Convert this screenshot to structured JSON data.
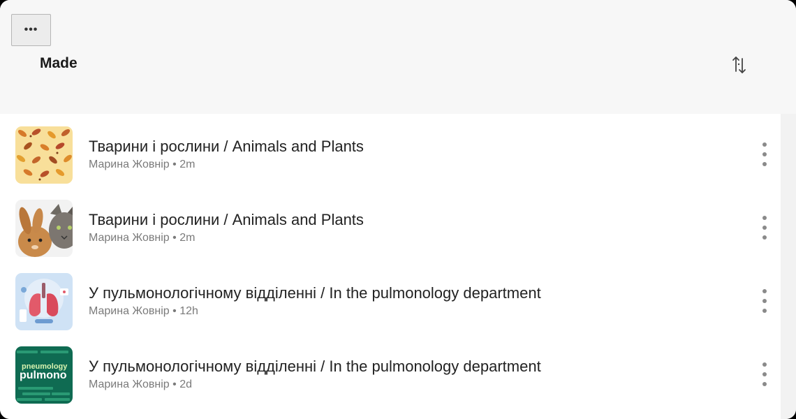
{
  "header": {
    "more_label": "•••",
    "title": "Made",
    "more_icon": "more-horizontal-icon",
    "sort_icon": "sort-arrows-icon"
  },
  "items": [
    {
      "title": "Тварини і рослини / Animals and Plants",
      "author": "Марина Жовнір",
      "age": "2m",
      "subtitle": "Марина Жовнір • 2m",
      "thumbnail": "autumn-leaves-pattern"
    },
    {
      "title": "Тварини і рослини / Animals and Plants",
      "author": "Марина Жовнір",
      "age": "2m",
      "subtitle": "Марина Жовнір • 2m",
      "thumbnail": "rabbit-and-cat-photo"
    },
    {
      "title": "У пульмонологічному відділенні / In the pulmonology department",
      "author": "Марина Жовнір",
      "age": "12h",
      "subtitle": "Марина Жовнір • 12h",
      "thumbnail": "lungs-illustration"
    },
    {
      "title": "У пульмонологічному відділенні / In the pulmonology department",
      "author": "Марина Жовнір",
      "age": "2d",
      "subtitle": "Марина Жовнір • 2d",
      "thumbnail": "pulmonology-word-cloud",
      "thumbnail_text": [
        "pneumology",
        "pulmono"
      ]
    }
  ],
  "colors": {
    "header_bg": "#f7f7f7",
    "list_bg": "#ffffff",
    "title_text": "#222222",
    "subtitle_text": "#7a7a7a",
    "kebab_dots": "#8a8a8a"
  }
}
